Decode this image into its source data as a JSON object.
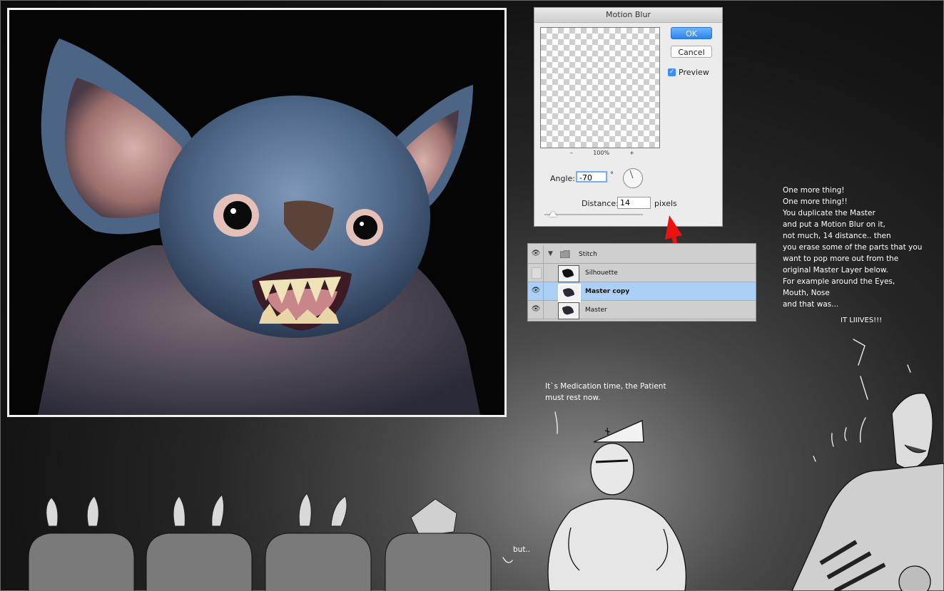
{
  "dialog": {
    "title": "Motion Blur",
    "ok_label": "OK",
    "cancel_label": "Cancel",
    "preview_label": "Preview",
    "preview_checked": true,
    "zoom_minus": "–",
    "zoom_level": "100%",
    "zoom_plus": "+",
    "angle_label": "Angle:",
    "angle_value": "-70",
    "angle_unit": "°",
    "distance_label": "Distance:",
    "distance_value": "14",
    "distance_unit": "pixels"
  },
  "layers": {
    "group_name": "Stitch",
    "items": [
      {
        "name": "Silhouette",
        "visible": false,
        "selected": false
      },
      {
        "name": "Master copy",
        "visible": true,
        "selected": true
      },
      {
        "name": "Master",
        "visible": true,
        "selected": false
      }
    ]
  },
  "notes": {
    "lines": [
      "One more thing!",
      "One more thing!!",
      "You duplicate the Master",
      "and put a Motion Blur on it,",
      "not much, 14 distance.. then",
      "you erase some of the parts that you",
      "want to pop more out from the",
      "original Master Layer below.",
      "For example around the Eyes,",
      "Mouth, Nose",
      "and that was..."
    ],
    "exclaim": "IT LIIIVES!!!"
  },
  "nurse": {
    "line1": "It`s Medication time, the Patient",
    "line2": "must rest now."
  },
  "audience": {
    "but_text": "but.."
  },
  "page": {
    "label": "page11"
  },
  "colors": {
    "accent_blue": "#2d84f1",
    "arrow_red": "#ee1111",
    "selection": "#acd0f5"
  }
}
